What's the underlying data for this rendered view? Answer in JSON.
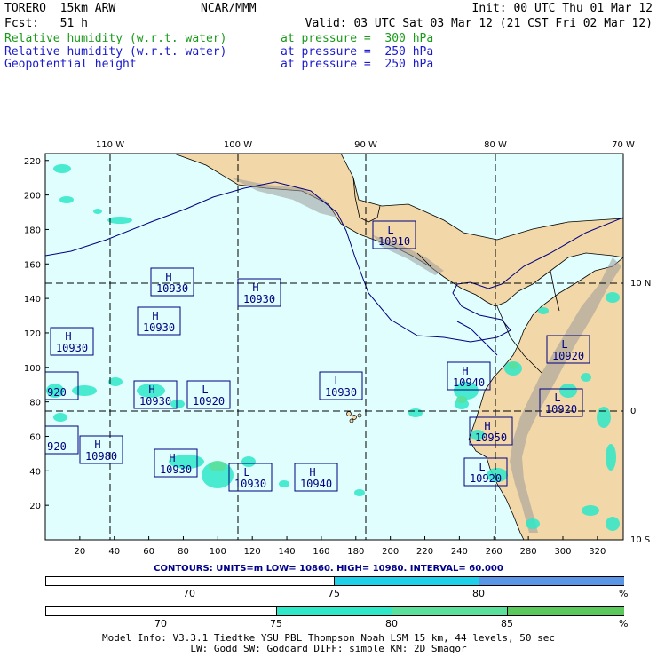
{
  "header": {
    "model": "TORERO  15km ARW",
    "center": "NCAR/MMM",
    "init": "Init: 00 UTC Thu 01 Mar 12",
    "fcst": "Fcst:   51 h",
    "valid": "Valid: 03 UTC Sat 03 Mar 12 (21 CST Fri 02 Mar 12)",
    "fields": [
      {
        "name": "Relative humidity (w.r.t. water)",
        "level": "at pressure =  300 hPa",
        "color": "#1a9a1a"
      },
      {
        "name": "Relative humidity (w.r.t. water)",
        "level": "at pressure =  250 hPa",
        "color": "#1a1acc"
      },
      {
        "name": "Geopotential height",
        "level": "at pressure =  250 hPa",
        "color": "#1a1acc"
      }
    ]
  },
  "map": {
    "lon_labels": [
      "110 W",
      "100 W",
      "90 W",
      "80 W",
      "70 W"
    ],
    "lat_labels": [
      "10 N",
      "0",
      "10 S"
    ],
    "x_ticks": [
      "20",
      "40",
      "60",
      "80",
      "100",
      "120",
      "140",
      "160",
      "180",
      "200",
      "220",
      "240",
      "260",
      "280",
      "300",
      "320"
    ],
    "y_ticks": [
      "20",
      "40",
      "60",
      "80",
      "100",
      "120",
      "140",
      "160",
      "180",
      "200",
      "220"
    ],
    "colors": {
      "ocean": "#e0fefe",
      "land": "#f2d7a8",
      "terrain": "#9a9a9a",
      "contour": "#000080",
      "grid": "#000000"
    },
    "pressure_centers": [
      {
        "type": "L",
        "value": "10910"
      },
      {
        "type": "H",
        "value": "10930"
      },
      {
        "type": "H",
        "value": "10930"
      },
      {
        "type": "H",
        "value": "10930"
      },
      {
        "type": "H",
        "value": "10930"
      },
      {
        "type": "L",
        "value": "10930"
      },
      {
        "type": "H",
        "value": "10930"
      },
      {
        "type": "L",
        "value": "10920"
      },
      {
        "type": "",
        "value": "920"
      },
      {
        "type": "H",
        "value": "10940"
      },
      {
        "type": "L",
        "value": "10920"
      },
      {
        "type": "L",
        "value": "10920"
      },
      {
        "type": "H",
        "value": "10950"
      },
      {
        "type": "",
        "value": "920"
      },
      {
        "type": "H",
        "value": "10980"
      },
      {
        "type": "H",
        "value": "10930"
      },
      {
        "type": "L",
        "value": "10930"
      },
      {
        "type": "H",
        "value": "10940"
      },
      {
        "type": "L",
        "value": "10920"
      }
    ]
  },
  "contours_info": "CONTOURS:  UNITS=m  LOW=  10860.    HIGH=  10980.    INTERVAL=   60.000",
  "colorbar1": {
    "labels": [
      "70",
      "75",
      "80",
      "%"
    ],
    "colors": [
      "#ffffff",
      "#1ed0e8",
      "#5a96e6"
    ]
  },
  "colorbar2": {
    "labels": [
      "70",
      "75",
      "80",
      "85",
      "%"
    ],
    "colors": [
      "#ffffff",
      "#2ee8c8",
      "#5ae09a",
      "#5ac85a"
    ]
  },
  "footer": {
    "line1": "Model Info: V3.3.1  Tiedtke YSU PBL  Thompson   Noah LSM  15 km,   44 levels,   50 sec",
    "line2": "LW: Godd SW: Goddard DIFF: simple KM: 2D Smagor"
  }
}
